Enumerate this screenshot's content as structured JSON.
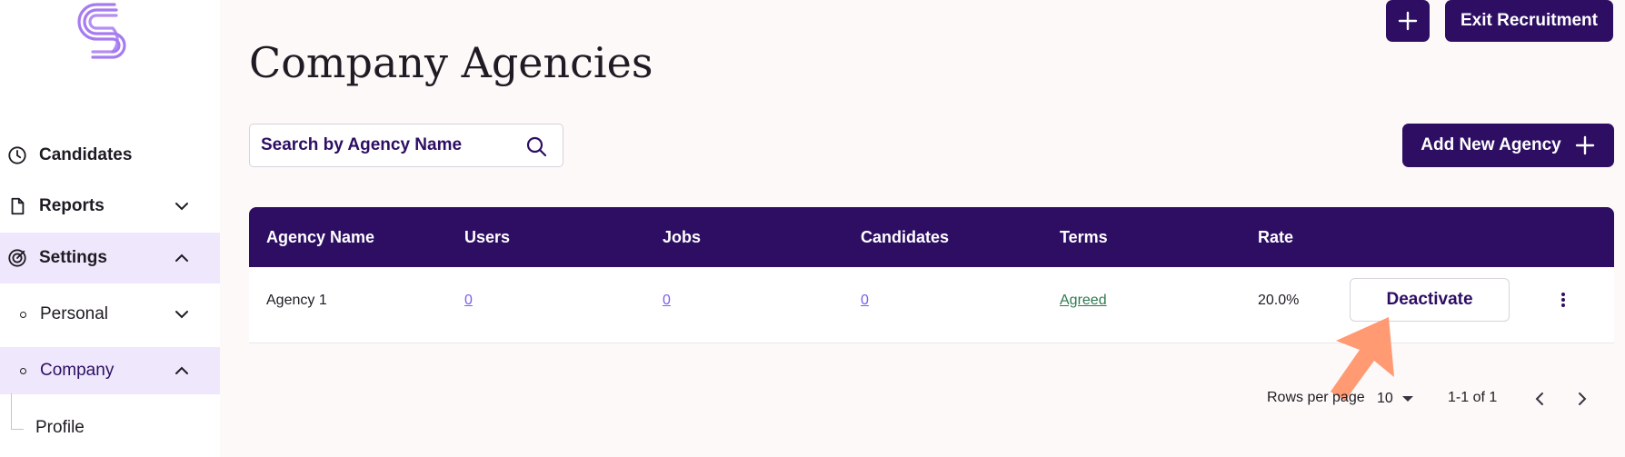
{
  "sidebar": {
    "items": [
      {
        "label": "Candidates",
        "icon": "clock-icon"
      },
      {
        "label": "Reports",
        "icon": "document-icon"
      },
      {
        "label": "Settings",
        "icon": "settings-icon"
      }
    ],
    "sub_items": [
      {
        "label": "Personal"
      },
      {
        "label": "Company"
      }
    ],
    "leaf": {
      "label": "Profile"
    }
  },
  "header": {
    "exit_label": "Exit Recruitment",
    "title": "Company Agencies"
  },
  "search": {
    "placeholder": "Search by Agency Name"
  },
  "add_agency_label": "Add New Agency",
  "table": {
    "headers": [
      "Agency Name",
      "Users",
      "Jobs",
      "Candidates",
      "Terms",
      "Rate"
    ],
    "rows": [
      {
        "agency": "Agency 1",
        "users": "0",
        "jobs": "0",
        "candidates": "0",
        "terms": "Agreed",
        "rate": "20.0%",
        "action": "Deactivate"
      }
    ]
  },
  "pagination": {
    "rows_label": "Rows per page",
    "rows_value": "10",
    "range": "1-1 of 1"
  },
  "colors": {
    "accent": "#2d0e63",
    "active_bg": "#efe8fc",
    "link": "#7b5cf0",
    "terms": "#2e7a4f",
    "pointer": "#ff9a73"
  }
}
